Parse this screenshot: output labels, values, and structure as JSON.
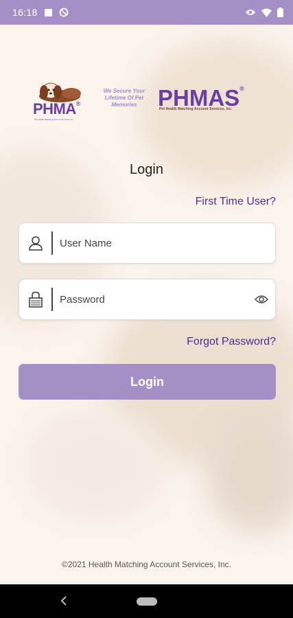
{
  "status_bar": {
    "time": "16:18",
    "icons": [
      "square-notification-icon",
      "no-sign-icon",
      "eye-status-icon",
      "wifi-icon",
      "battery-icon"
    ]
  },
  "logo": {
    "phma": "PHMA",
    "phma_sub": "Pet Health Matching Account Services, Inc.",
    "tagline": "We Secure Your Lifetime Of Pet Memories",
    "phmas": "PHMAS",
    "phmas_sub": "Pet Health Matching Account Services, Inc."
  },
  "login": {
    "title": "Login",
    "first_time_link": "First Time User?",
    "username_placeholder": "User Name",
    "password_placeholder": "Password",
    "forgot_link": "Forgot Password?",
    "button_label": "Login"
  },
  "footer": {
    "copyright": "©2021 Health Matching Account Services, Inc."
  },
  "colors": {
    "accent": "#a48fc6",
    "link": "#4a2f8e",
    "brand_purple": "#6a3ea3"
  }
}
